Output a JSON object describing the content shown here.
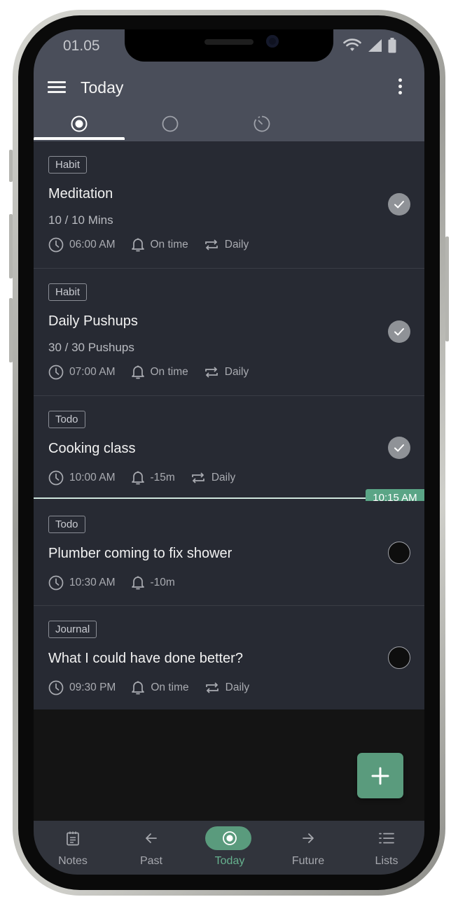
{
  "status": {
    "time": "01.05"
  },
  "appbar": {
    "title": "Today"
  },
  "tabs": [
    {
      "name": "today",
      "icon": "radio-selected-icon",
      "selected": true
    },
    {
      "name": "pending",
      "icon": "circle-outline-icon",
      "selected": false
    },
    {
      "name": "history",
      "icon": "progress-circle-icon",
      "selected": false
    }
  ],
  "items": [
    {
      "tag": "Habit",
      "title": "Meditation",
      "progress": "10 / 10 Mins",
      "time": "06:00 AM",
      "reminder": "On time",
      "repeat": "Daily",
      "done": true
    },
    {
      "tag": "Habit",
      "title": "Daily Pushups",
      "progress": "30 / 30 Pushups",
      "time": "07:00 AM",
      "reminder": "On time",
      "repeat": "Daily",
      "done": true
    },
    {
      "tag": "Todo",
      "title": "Cooking class",
      "time": "10:00 AM",
      "reminder": "-15m",
      "repeat": "Daily",
      "done": true
    },
    {
      "tag": "Todo",
      "title": "Plumber coming to fix shower",
      "time": "10:30 AM",
      "reminder": "-10m",
      "done": false
    },
    {
      "tag": "Journal",
      "title": "What I could have done better?",
      "time": "09:30 PM",
      "reminder": "On time",
      "repeat": "Daily",
      "done": false
    }
  ],
  "now_marker": "10:15 AM",
  "nav": [
    {
      "label": "Notes",
      "icon": "notes-icon"
    },
    {
      "label": "Past",
      "icon": "arrow-left-icon"
    },
    {
      "label": "Today",
      "icon": "radio-selected-icon",
      "active": true
    },
    {
      "label": "Future",
      "icon": "arrow-right-icon"
    },
    {
      "label": "Lists",
      "icon": "list-icon"
    }
  ],
  "colors": {
    "accent": "#5a9b7d",
    "appbar": "#4a4e5a",
    "card": "#272a33",
    "background": "#141414"
  }
}
